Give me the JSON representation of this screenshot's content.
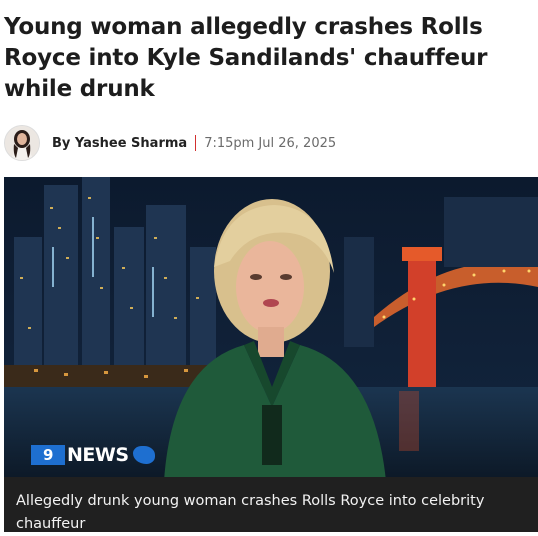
{
  "article": {
    "headline": "Young woman allegedly crashes Rolls Royce into Kyle Sandilands' chauffeur while drunk",
    "author": "By Yashee Sharma",
    "timestamp": "7:15pm Jul 26, 2025"
  },
  "media": {
    "logo_mark": "9",
    "logo_text": "NEWS",
    "caption": "Allegedly drunk young woman crashes Rolls Royce into celebrity chauffeur"
  },
  "icons": {
    "avatar": "author-avatar",
    "logo": "nine-news-logo"
  }
}
